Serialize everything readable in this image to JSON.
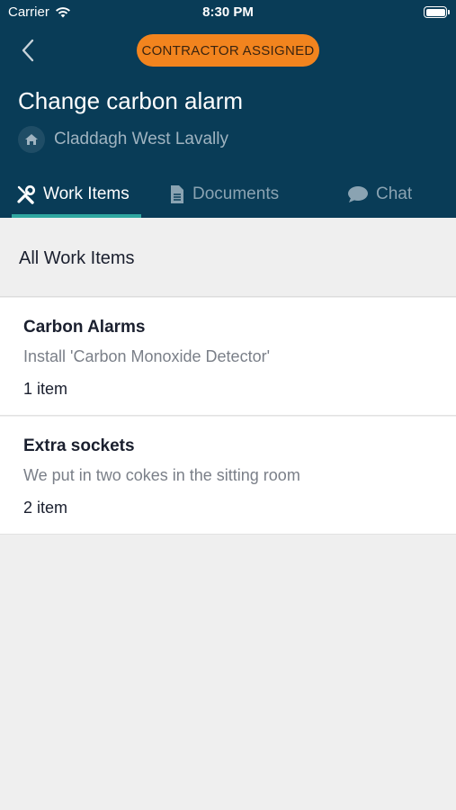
{
  "status_bar": {
    "carrier": "Carrier",
    "time": "8:30 PM"
  },
  "header": {
    "status_badge": "CONTRACTOR ASSIGNED",
    "title": "Change carbon alarm",
    "location": "Claddagh West Lavally",
    "colors": {
      "background": "#093c57",
      "badge": "#f2841e",
      "active_tab_underline": "#2fa7a0"
    }
  },
  "tabs": [
    {
      "label": "Work Items",
      "icon": "wrench-screwdriver-icon",
      "active": true
    },
    {
      "label": "Documents",
      "icon": "document-icon",
      "active": false
    },
    {
      "label": "Chat",
      "icon": "chat-bubble-icon",
      "active": false
    }
  ],
  "section": {
    "title": "All Work Items"
  },
  "work_items": [
    {
      "title": "Carbon Alarms",
      "description": "Install 'Carbon Monoxide Detector'",
      "count": "1 item"
    },
    {
      "title": "Extra sockets",
      "description": "We put in two cokes in the sitting room",
      "count": "2 item"
    }
  ]
}
